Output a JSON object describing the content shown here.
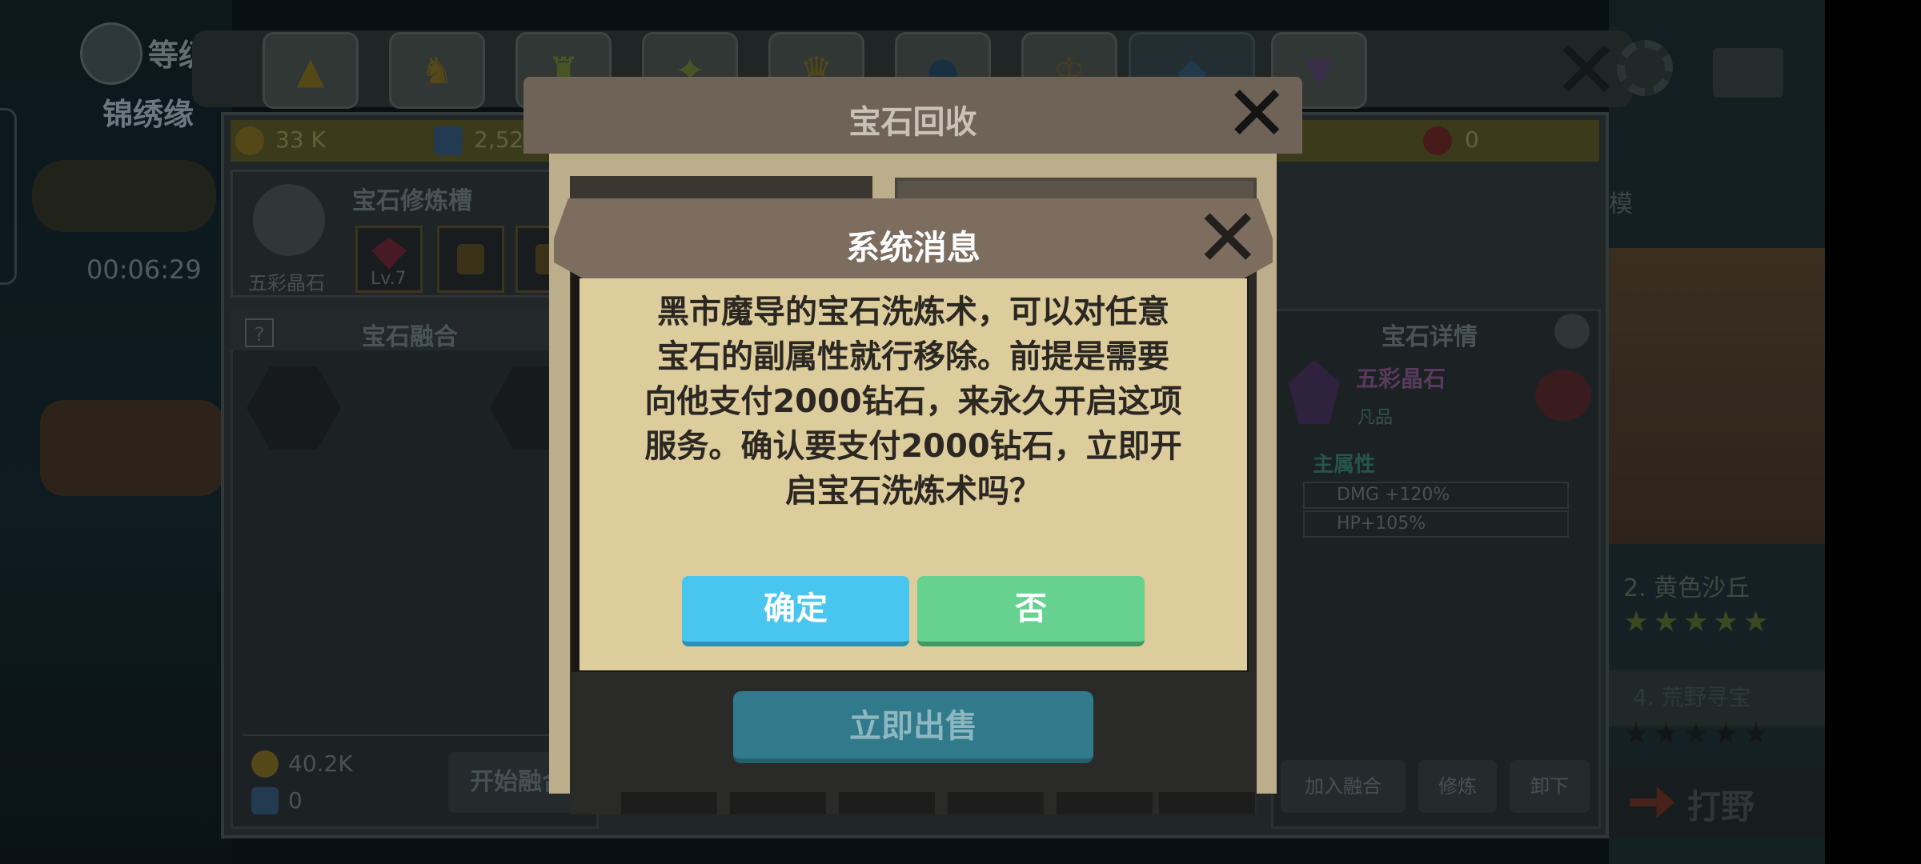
{
  "background": {
    "level_label": "等级",
    "title_label": "锦绣缘",
    "timer": "00:06:29",
    "resources": {
      "gold": "33 K",
      "diamond": "2,52",
      "ruby": "0"
    },
    "slot_panel": {
      "title": "宝石修炼槽",
      "gem_name": "五彩晶石",
      "level": "Lv.7"
    },
    "fusion_panel": {
      "title": "宝石融合",
      "help": "?",
      "gold_cost": "40.2K",
      "diamond_cost": "0",
      "start_button": "开始融合"
    },
    "detail_panel": {
      "title": "宝石详情",
      "gem_name": "五彩晶石",
      "grade": "凡品",
      "main_attr_title": "主属性",
      "attrs": [
        "DMG +120%",
        "HP+105%"
      ],
      "buttons": [
        "加入融合",
        "修炼",
        "卸下"
      ]
    },
    "right_panel": {
      "stage": "2. 黄色沙丘",
      "hunt": "4. 荒野寻宝",
      "fight": "打野",
      "edge": "模"
    }
  },
  "recycle_modal": {
    "title": "宝石回收",
    "sell_button": "立即出售"
  },
  "dialog": {
    "title": "系统消息",
    "message_lines": [
      "黑市魔导的宝石洗炼术，可以对任意",
      "宝石的副属性就行移除。前提是需要",
      "向他支付2000钻石，来永久开启这项",
      "服务。确认要支付2000钻石，立即开",
      "启宝石洗炼术吗？"
    ],
    "confirm_button": "确定",
    "cancel_button": "否"
  },
  "colors": {
    "confirm": "#49c6ef",
    "cancel": "#67d190",
    "dialog_body": "#ddcd9d",
    "dialog_header": "#7d6d5f"
  }
}
